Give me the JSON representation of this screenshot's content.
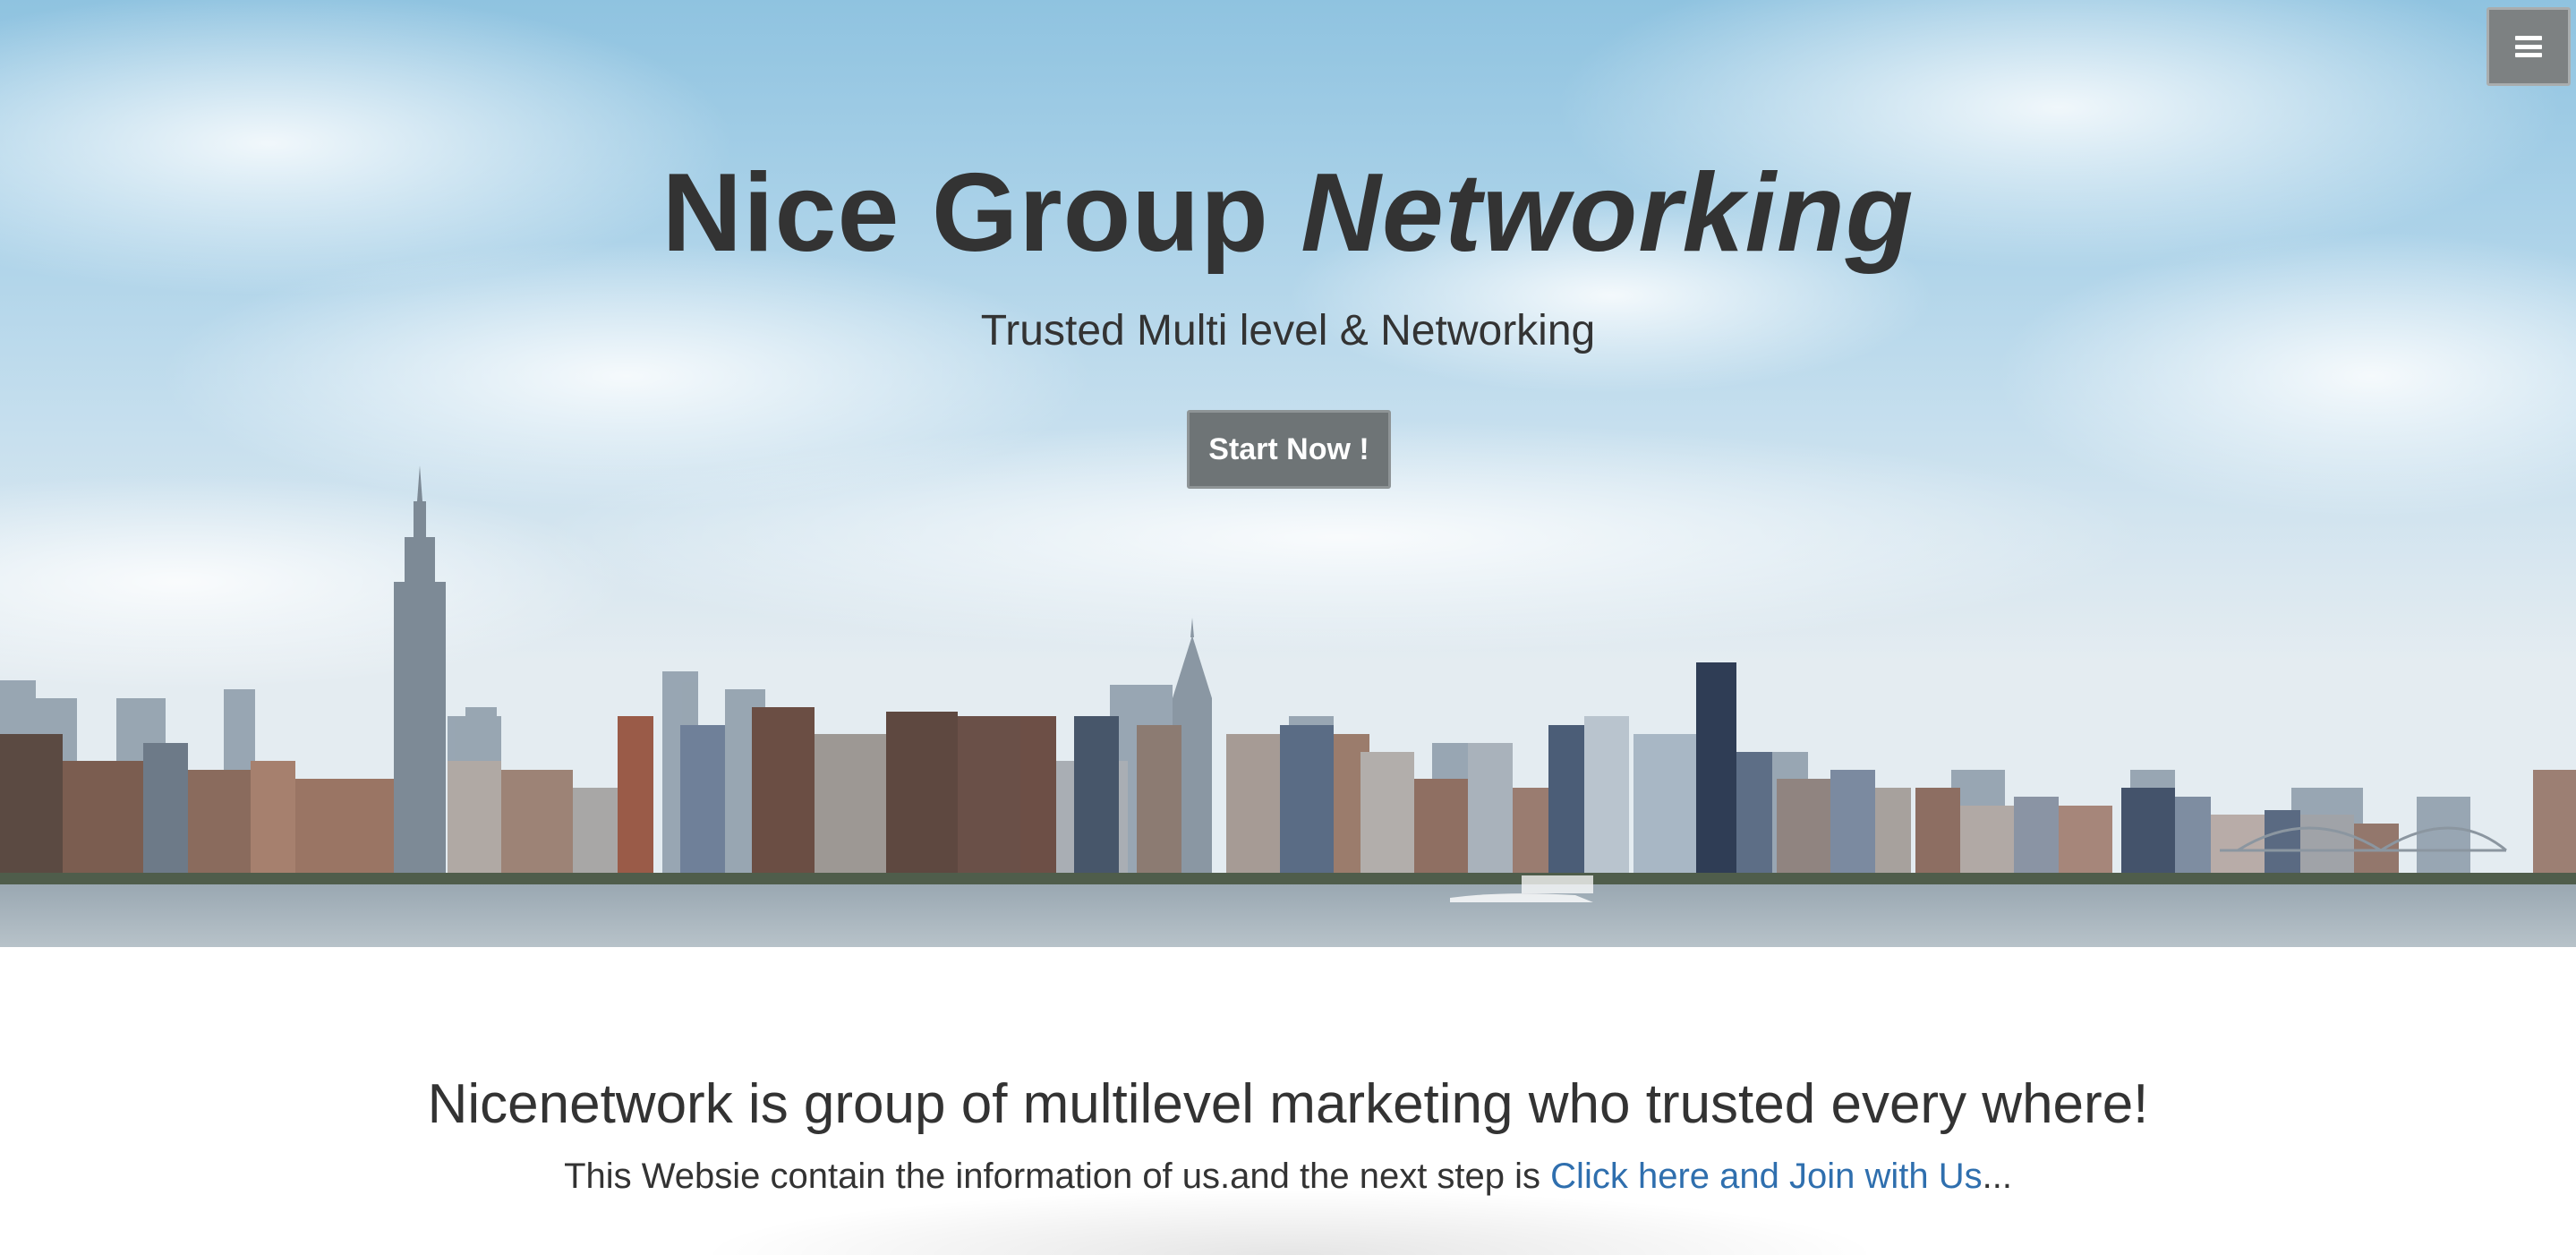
{
  "hero": {
    "title_main": "Nice Group",
    "title_accent": "Networking",
    "subtitle": "Trusted Multi level & Networking",
    "start_button_label": "Start Now !"
  },
  "nav": {
    "menu_icon": "hamburger-menu-icon"
  },
  "info": {
    "heading": "Nicenetwork is group of multilevel marketing who trusted every where!",
    "text_prefix": "This Websie contain the information of us.and the next step is",
    "link_label": "Click here and Join with Us",
    "text_suffix": "..."
  },
  "colors": {
    "heading_text": "#333333",
    "link": "#2f6fae",
    "button_bg": "#6e7476",
    "menu_bg": "#7d8182"
  }
}
